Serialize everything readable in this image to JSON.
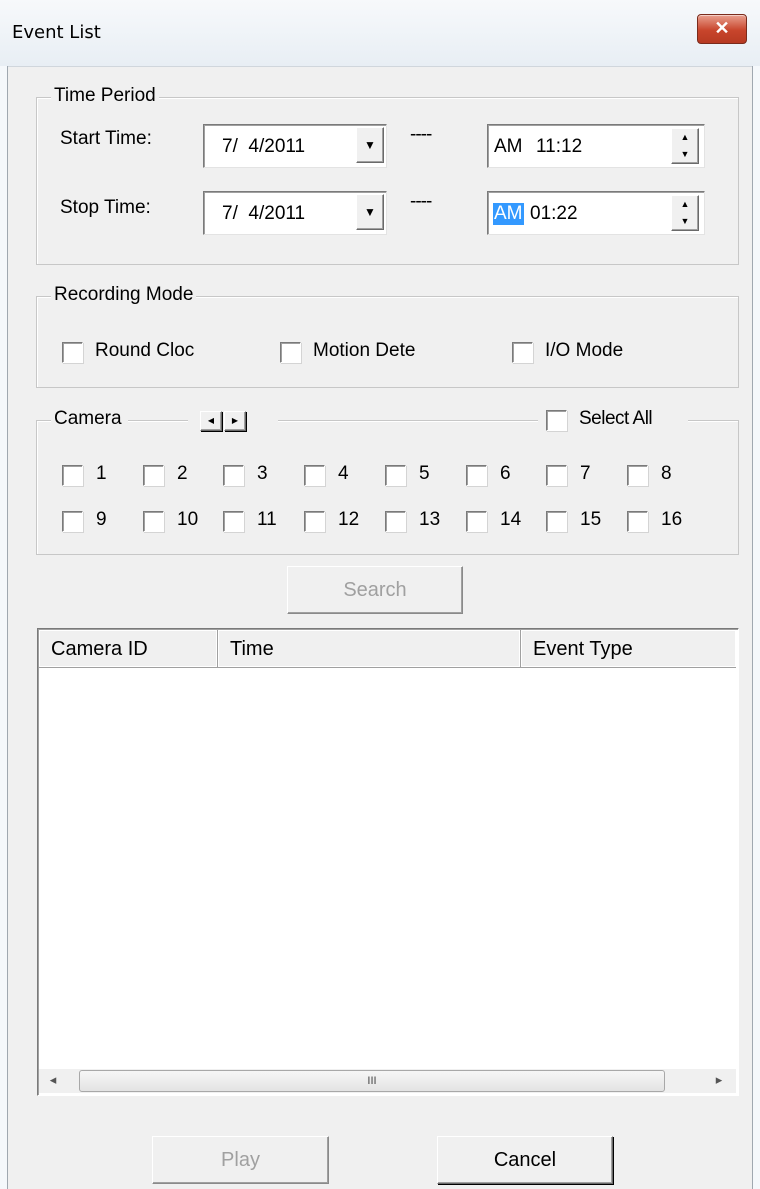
{
  "window": {
    "title": "Event List",
    "close_glyph": "✕"
  },
  "time_period": {
    "legend": "Time Period",
    "start_label": "Start Time:",
    "start_date": "7/  4/2011",
    "start_ampm": "AM",
    "start_time": "11:12",
    "stop_label": "Stop Time:",
    "stop_date": "7/  4/2011",
    "stop_ampm": "AM",
    "stop_time": "01:22",
    "separator": "----"
  },
  "recording_mode": {
    "legend": "Recording Mode",
    "options": [
      "Round Cloc",
      "Motion Dete",
      "I/O Mode"
    ]
  },
  "camera": {
    "legend": "Camera",
    "select_all": "Select All",
    "numbers": [
      "1",
      "2",
      "3",
      "4",
      "5",
      "6",
      "7",
      "8",
      "9",
      "10",
      "11",
      "12",
      "13",
      "14",
      "15",
      "16"
    ]
  },
  "search_button": "Search",
  "event_list": {
    "columns": [
      "Camera ID",
      "Time",
      "Event Type"
    ],
    "rows": []
  },
  "scroll_thumb_glyph": "III",
  "play_button": "Play",
  "cancel_button": "Cancel",
  "icons": {
    "dropdown": "arrow-down-icon",
    "spin": "spin-up-down-icon",
    "page_prev": "arrow-left-icon",
    "page_next": "arrow-right-icon"
  },
  "colors": {
    "selection": "#3399ff",
    "close_button": "#c8452c"
  }
}
